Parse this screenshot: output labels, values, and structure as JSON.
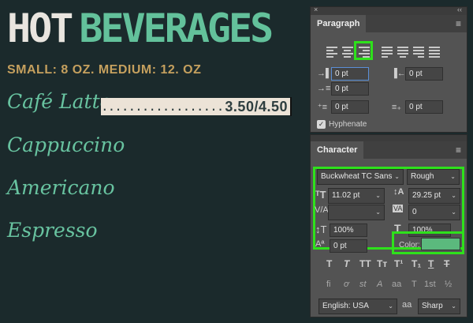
{
  "canvas": {
    "title_word1": "HOT",
    "title_word2": "BEVERAGES",
    "sizes": "SMALL: 8 OZ. MEDIUM: 12. OZ",
    "items": [
      {
        "name": "Café Latte"
      },
      {
        "name": "Cappuccino"
      },
      {
        "name": "Americano"
      },
      {
        "name": "Espresso"
      }
    ],
    "leader": "......................",
    "price": "3.50/4.50"
  },
  "paragraph_panel": {
    "tab": "Paragraph",
    "close_icon": "×",
    "collapse_icon": "‹‹",
    "menu_icon": "≡",
    "indent_left_value": "0 pt",
    "indent_right_value": "0 pt",
    "first_line_value": "0 pt",
    "space_before_value": "0 pt",
    "space_after_value": "0 pt",
    "hyphenate_label": "Hyphenate"
  },
  "character_panel": {
    "tab": "Character",
    "menu_icon": "≡",
    "font_family": "Buckwheat TC Sans",
    "font_style": "Rough",
    "font_size": "11.02 pt",
    "leading": "29.25 pt",
    "kerning": "",
    "tracking": "0",
    "vertical_scale": "100%",
    "horizontal_scale": "100%",
    "baseline_shift": "0 pt",
    "color_label": "Color:",
    "color_swatch": "#5bb97d",
    "type_styles": [
      "T",
      "T",
      "TT",
      "Tт",
      "T¹",
      "T₁",
      "T",
      "T"
    ],
    "opentype": [
      "fi",
      "ơ",
      "st",
      "A",
      "aa",
      "T",
      "1st",
      "½"
    ],
    "language": "English: USA",
    "aa_icon": "aa",
    "anti_alias": "Sharp"
  },
  "colors": {
    "highlight": "#2ee11b",
    "menu_green": "#63c19b",
    "menu_gold": "#c5a05e",
    "background": "#1b2a2c"
  }
}
